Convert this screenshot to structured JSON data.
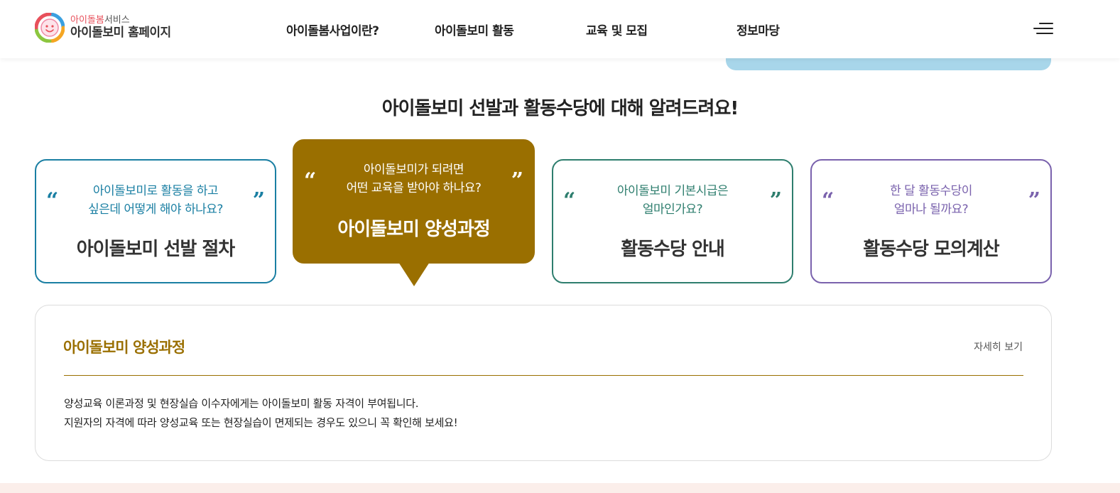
{
  "header": {
    "logo_sub_accent": "아이돌봄",
    "logo_sub_rest": "서비스",
    "logo_main": "아이돌보미 홈페이지",
    "nav": [
      {
        "label": "아이돌봄사업이란?"
      },
      {
        "label": "아이돌보미 활동"
      },
      {
        "label": "교육 및 모집"
      },
      {
        "label": "정보마당"
      }
    ],
    "menu_icon": "hamburger-menu-icon"
  },
  "section": {
    "title_regular": "아이돌보미 선발과 활동수당에 대해 ",
    "title_bold": "알려드려요!"
  },
  "cards": [
    {
      "q1": "아이돌보미로 활동을 하고",
      "q2": "싶은데 어떻게 해야 하나요?",
      "title": "아이돌보미 선발 절차",
      "color": "#1a7fa3",
      "open_quote": "“",
      "close_quote": "”"
    },
    {
      "q1": "아이돌보미가 되려면",
      "q2": "어떤 교육을 받아야 하나요?",
      "title": "아이돌보미 양성과정",
      "color": "#9a6f00",
      "open_quote": "“",
      "close_quote": "”"
    },
    {
      "q1": "아이돌보미 기본시급은",
      "q2": "얼마인가요?",
      "title": "활동수당 안내",
      "color": "#2e7e6e",
      "open_quote": "“",
      "close_quote": "”"
    },
    {
      "q1": "한 달 활동수당이",
      "q2": "얼마나 될까요?",
      "title": "활동수당 모의계산",
      "color": "#7a62ad",
      "open_quote": "“",
      "close_quote": "”"
    }
  ],
  "active_card_index": 1,
  "panel": {
    "title": "아이돌보미 양성과정",
    "more_label": "자세히 보기",
    "line1": "양성교육 이론과정 및 현장실습 이수자에게는 아이돌보미 활동 자격이 부여됩니다.",
    "line2": "지원자의 자격에 따라 양성교육 또는 현장실습이 면제되는 경우도 있으니 꼭 확인해 보세요!"
  }
}
